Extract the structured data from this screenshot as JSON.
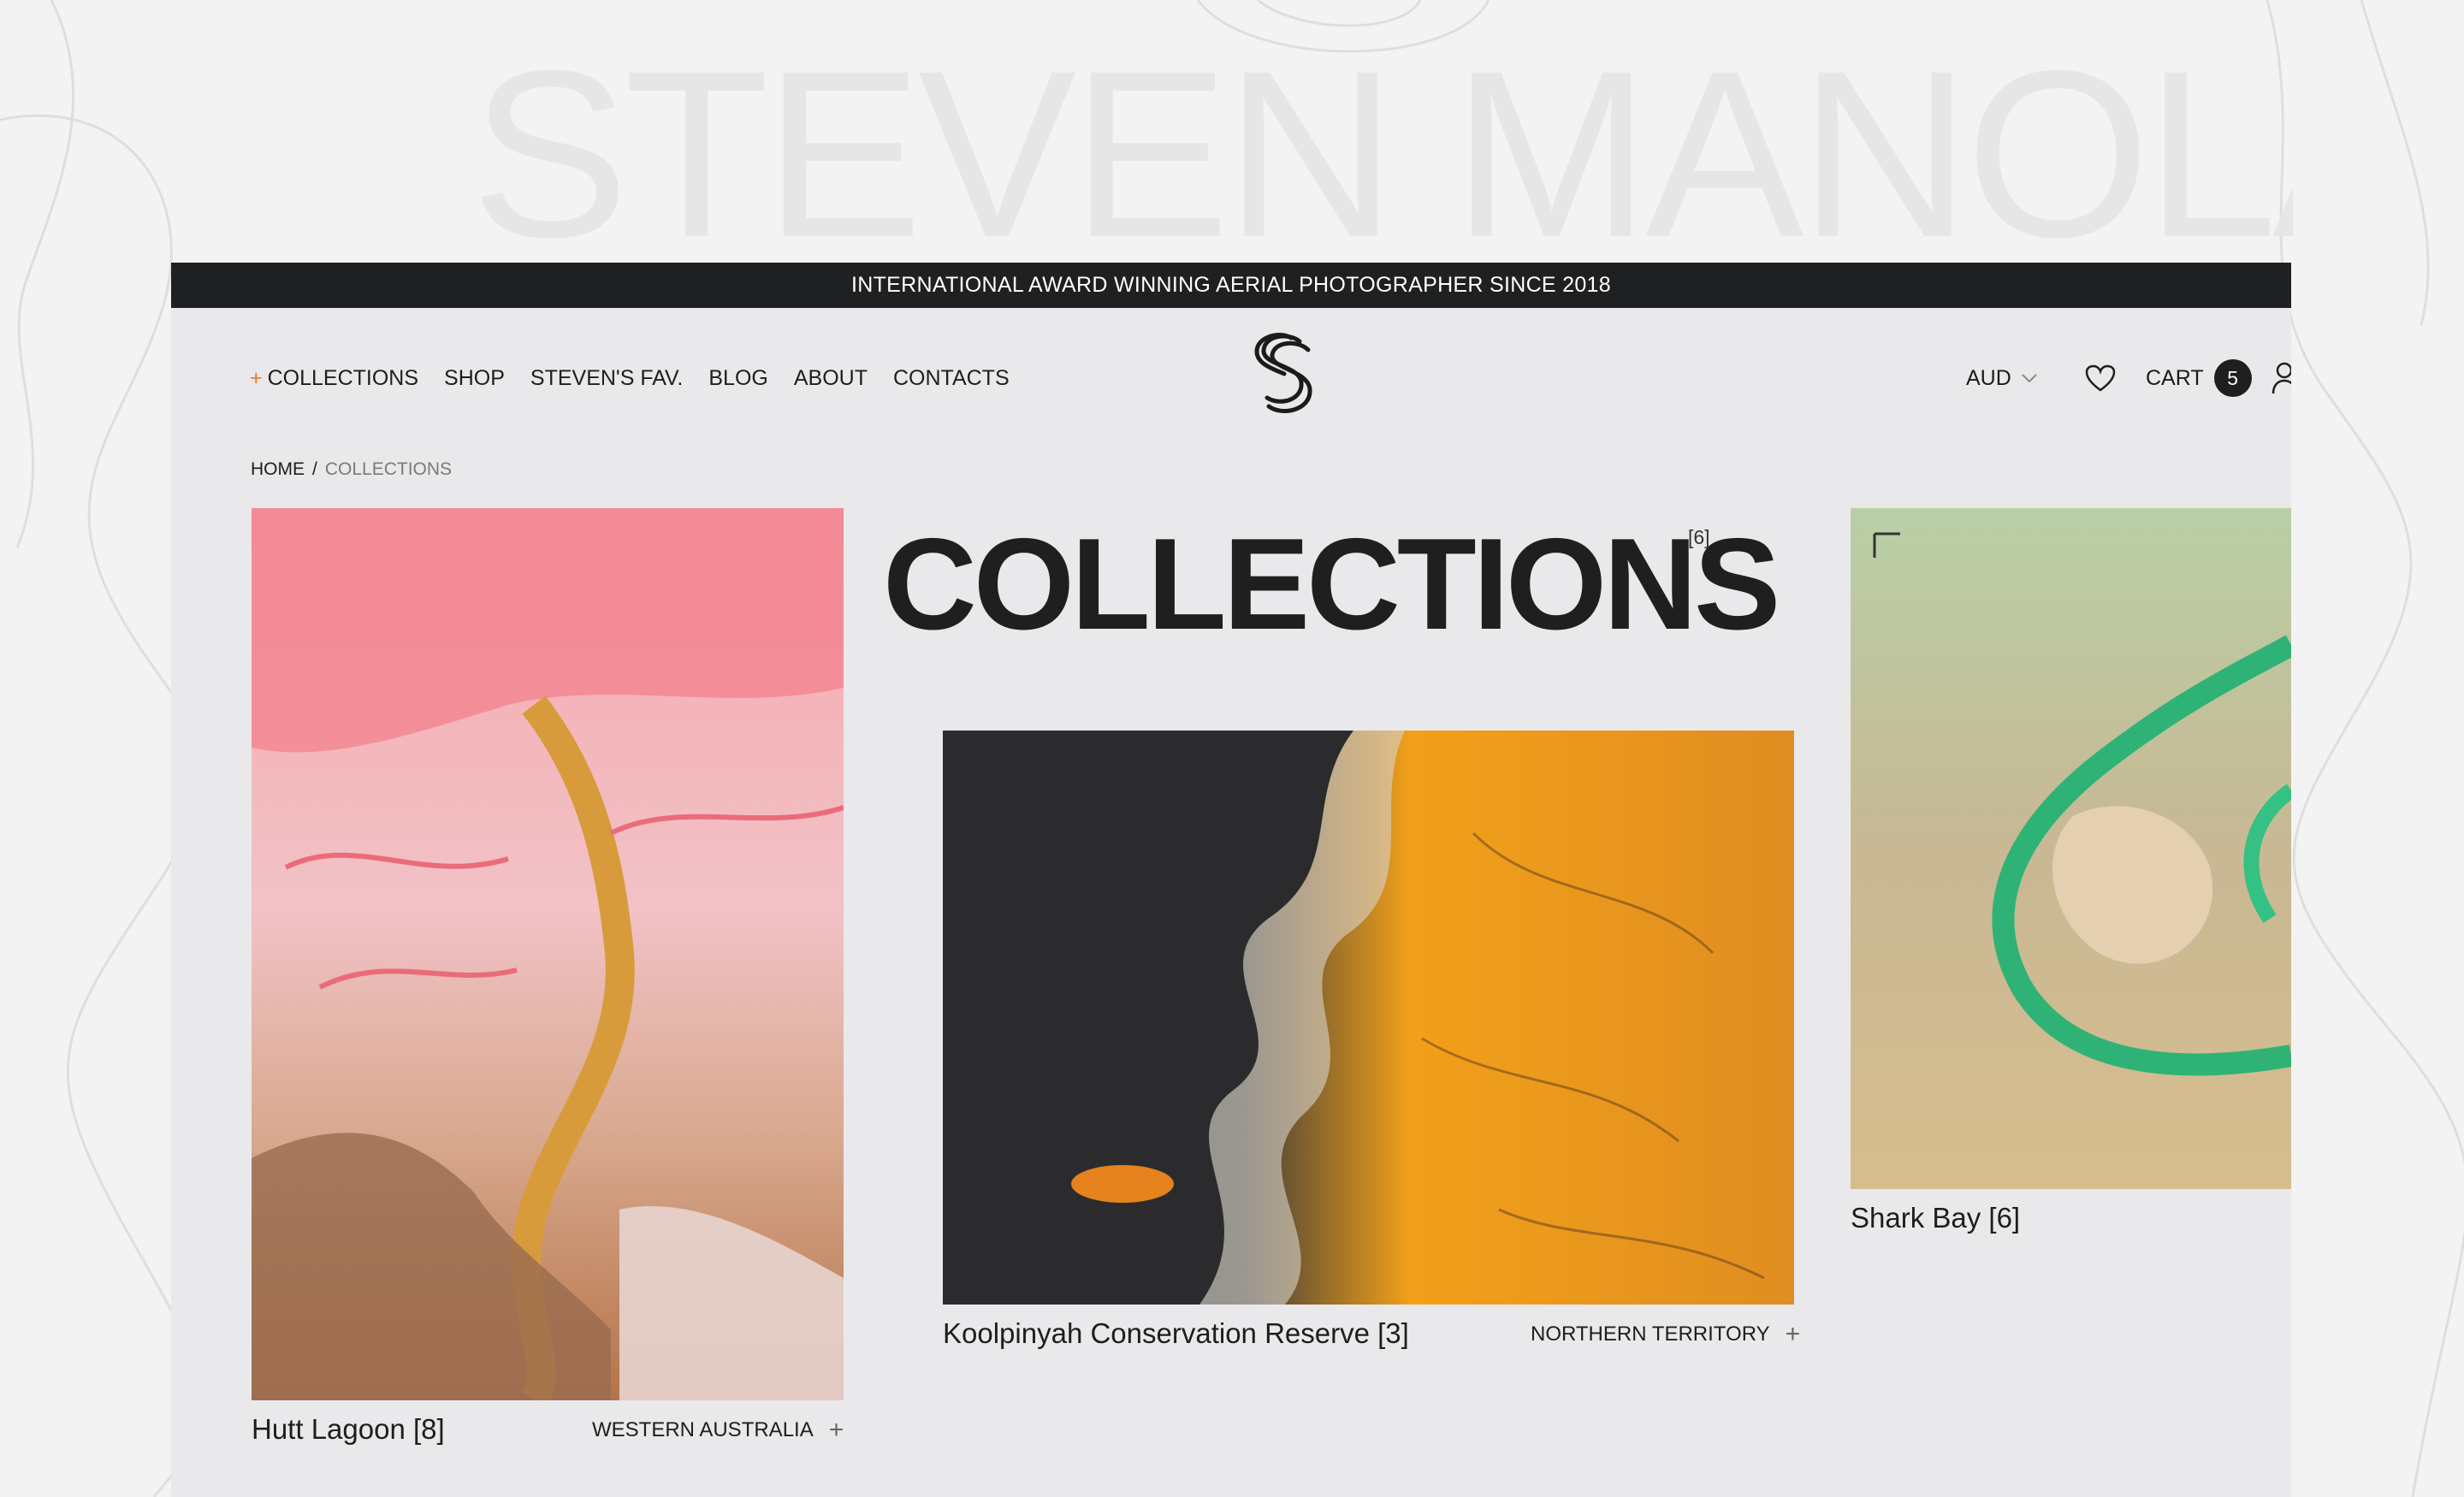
{
  "background": {
    "watermark_text": "STEVEN MANOLAKIS",
    "color": "#f3f3f3"
  },
  "announcement": {
    "text": "INTERNATIONAL AWARD WINNING AERIAL PHOTOGRAPHER SINCE 2018",
    "bg_color": "#1f2021"
  },
  "nav": {
    "plus": "+",
    "items": [
      {
        "label": "COLLECTIONS"
      },
      {
        "label": "SHOP"
      },
      {
        "label": "STEVEN'S FAV."
      },
      {
        "label": "BLOG"
      },
      {
        "label": "ABOUT"
      },
      {
        "label": "CONTACTS"
      }
    ],
    "accent_color": "#e07b2e"
  },
  "logo": {
    "icon": "ss-monogram-logo"
  },
  "header_right": {
    "currency": "AUD",
    "wishlist_icon": "heart-icon",
    "cart_label": "CART",
    "cart_count": "5",
    "account_icon": "user-icon"
  },
  "breadcrumb": {
    "home": "HOME",
    "separator": "/",
    "current": "COLLECTIONS"
  },
  "page": {
    "title": "COLLECTIONS",
    "count": "[6]"
  },
  "collections": [
    {
      "title": "Hutt Lagoon [8]",
      "region": "WESTERN AUSTRALIA",
      "plus": "+"
    },
    {
      "title": "Koolpinyah Conservation Reserve [3]",
      "region": "NORTHERN TERRITORY",
      "plus": "+"
    },
    {
      "title": "Shark Bay [6]"
    }
  ]
}
